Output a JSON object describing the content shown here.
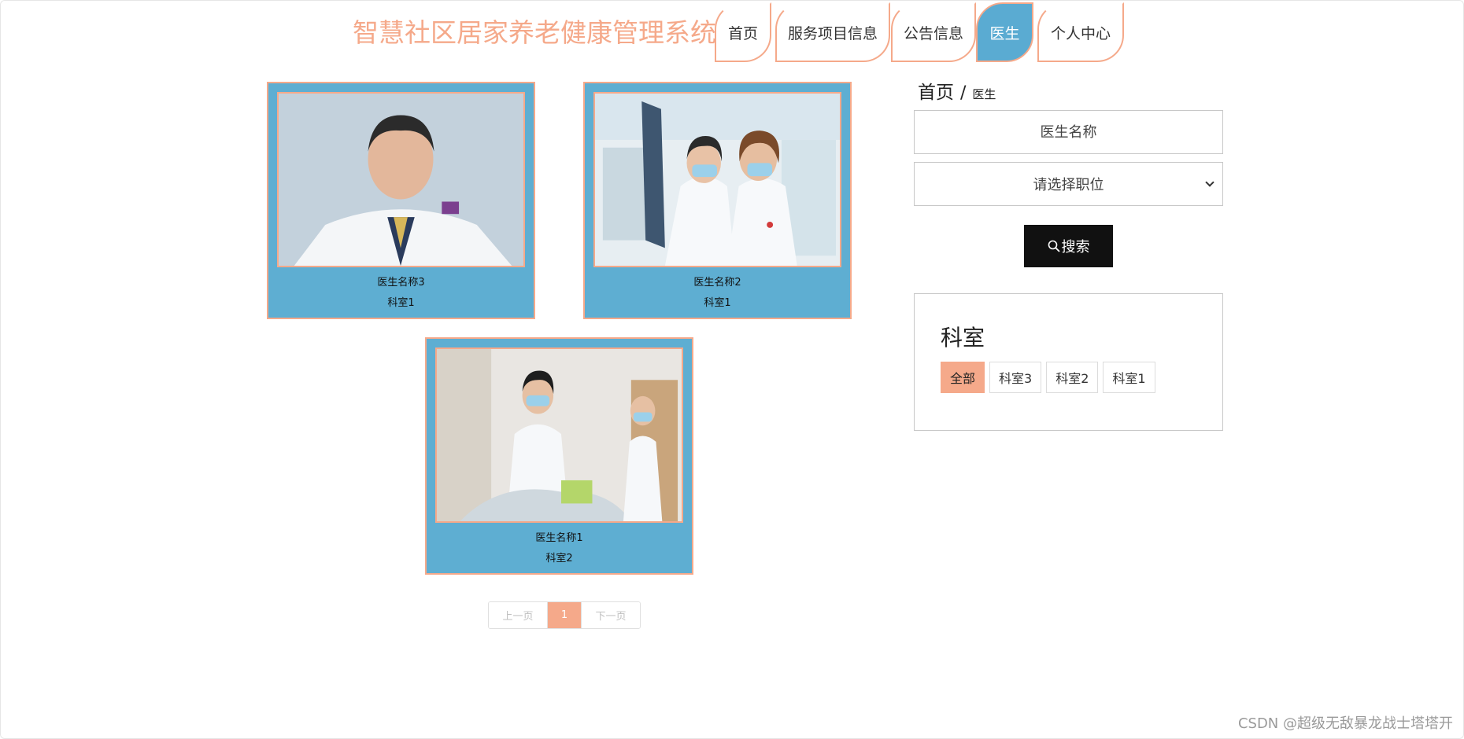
{
  "site": {
    "title": "智慧社区居家养老健康管理系统"
  },
  "nav": {
    "items": [
      {
        "label": "首页",
        "active": false
      },
      {
        "label": "服务项目信息",
        "active": false
      },
      {
        "label": "公告信息",
        "active": false
      },
      {
        "label": "医生",
        "active": true
      },
      {
        "label": "个人中心",
        "active": false
      }
    ]
  },
  "doctors": [
    {
      "name": "医生名称3",
      "dept": "科室1",
      "photo": "doctor-portrait-photo"
    },
    {
      "name": "医生名称2",
      "dept": "科室1",
      "photo": "doctors-reviewing-xray-photo"
    },
    {
      "name": "医生名称1",
      "dept": "科室2",
      "photo": "doctor-with-patient-photo"
    }
  ],
  "pagination": {
    "prev": "上一页",
    "current": "1",
    "next": "下一页"
  },
  "breadcrumb": {
    "home": "首页",
    "separator": "/",
    "current": "医生"
  },
  "search": {
    "name_placeholder": "医生名称",
    "position_select": "请选择职位",
    "button_label": "搜索"
  },
  "departments": {
    "title": "科室",
    "chips": [
      {
        "label": "全部",
        "active": true
      },
      {
        "label": "科室3",
        "active": false
      },
      {
        "label": "科室2",
        "active": false
      },
      {
        "label": "科室1",
        "active": false
      }
    ]
  },
  "watermark": "CSDN @超级无敌暴龙战士塔塔开",
  "colors": {
    "accent": "#f5a98a",
    "card_blue": "#5eaed2",
    "nav_active": "#5aabd2",
    "button": "#111111"
  }
}
